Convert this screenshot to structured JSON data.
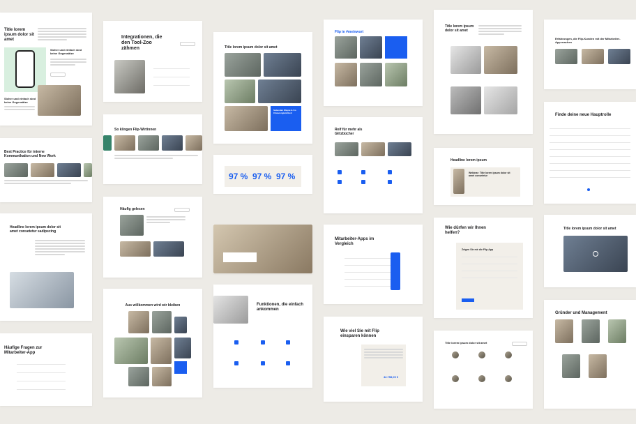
{
  "col1": {
    "card1_title": "Title lorem ipsum dolor sit amet",
    "card1_sub_a": "Sicher und einfach sind keine Gegensätze",
    "card1_sub_b": "Sicher und einfach sind keine Gegensätze",
    "card2_title": "Best Practice für interne Kommunikation und New Work",
    "card3_title": "Headline lorem ipsum dolor sit amet consetetur sadipscing",
    "card4_title": "Häufige Fragen zur Mitarbeiter-App"
  },
  "col2": {
    "card1_title": "Integrationen, die den Tool-Zoo zähmen",
    "card2_title": "So klingen Flip-Wirtinnen",
    "card3_title": "Häufig gelesen",
    "card4_title": "Aus willkommen wird wir bleiben"
  },
  "col3": {
    "card1_title": "Title lorem ipsum dolor sit amet",
    "card1_cta": "Sebastian Wayne & Co. Chancengleichheit",
    "stats": [
      "97 %",
      "97 %",
      "97 %"
    ],
    "card4_title": "Funktionen, die einfach ankommen"
  },
  "col4": {
    "card1_title": "Flip in #meinwort",
    "card2_title": "Reif für mehr als Glitzbücher",
    "card3_title": "Mitarbeiter-Apps im Vergleich",
    "card4_title": "Wie viel Sie mit Flip einsparen können",
    "card4_total": "42.758,00 €"
  },
  "col5": {
    "card1_title": "Title lorem ipsum dolor sit amet",
    "card2_title": "Headline lorem ipsum",
    "card2_webinar": "Webinar: Title lorem ipsum dolor sit amet consetetur",
    "card3_title": "Wie dürfen wir Ihnen helfen?",
    "card3_form": "Zeigen Sie mir die Flip-App",
    "card4_title": "Title lorem ipsum dolor sit amet"
  },
  "col6": {
    "card1_title": "Erfahrungen, die Flip-Kunden mit der Mitarbeiter-App machen",
    "card2_title": "Finde deine neue Hauptrolle",
    "card3_title": "Title lorem ipsum dolor sit amet",
    "card4_title": "Gründer und Management"
  },
  "colors": {
    "accent": "#1a5ef0",
    "background": "#edebe6"
  }
}
